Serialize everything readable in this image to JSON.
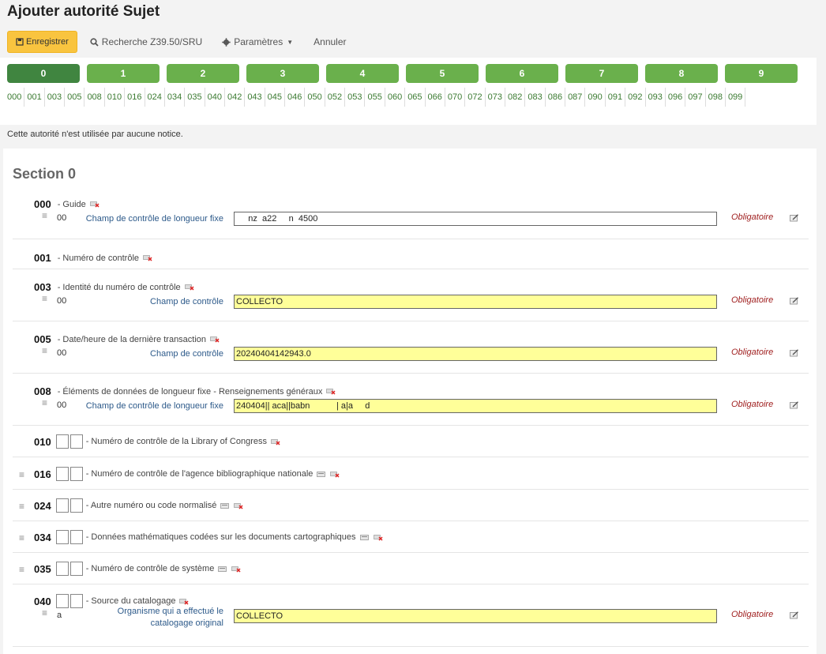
{
  "page": {
    "title": "Ajouter autorité Sujet"
  },
  "toolbar": {
    "save_label": "Enregistrer",
    "search_label": "Recherche Z39.50/SRU",
    "settings_label": "Paramètres",
    "cancel_label": "Annuler"
  },
  "tabs": [
    "0",
    "1",
    "2",
    "3",
    "4",
    "5",
    "6",
    "7",
    "8",
    "9"
  ],
  "field_links": [
    "000",
    "001",
    "003",
    "005",
    "008",
    "010",
    "016",
    "024",
    "034",
    "035",
    "040",
    "042",
    "043",
    "045",
    "046",
    "050",
    "052",
    "053",
    "055",
    "060",
    "065",
    "066",
    "070",
    "072",
    "073",
    "082",
    "083",
    "086",
    "087",
    "090",
    "091",
    "092",
    "093",
    "096",
    "097",
    "098",
    "099"
  ],
  "notice": "Cette autorité n'est utilisée par aucune notice.",
  "section_title": "Section 0",
  "mandatory_label": "Obligatoire",
  "tags": [
    {
      "num": "000",
      "desc": "- Guide",
      "sub": {
        "code": "00",
        "label": "Champ de contrôle de longueur fixe",
        "value": "     nz  a22     n  4500"
      }
    },
    {
      "num": "001",
      "desc": "- Numéro de contrôle"
    },
    {
      "num": "003",
      "desc": "- Identité du numéro de contrôle",
      "sub": {
        "code": "00",
        "label": "Champ de contrôle",
        "value": "COLLECTO"
      }
    },
    {
      "num": "005",
      "desc": "- Date/heure de la dernière transaction",
      "sub": {
        "code": "00",
        "label": "Champ de contrôle",
        "value": "20240404142943.0"
      }
    },
    {
      "num": "008",
      "desc": "- Éléments de données de longueur fixe - Renseignements généraux",
      "sub": {
        "code": "00",
        "label": "Champ de contrôle de longueur fixe",
        "value": "240404|| aca||babn           | a|a     d"
      }
    },
    {
      "num": "010",
      "desc": "- Numéro de contrôle de la Library of Congress"
    },
    {
      "num": "016",
      "desc": "- Numéro de contrôle de l'agence bibliographique nationale"
    },
    {
      "num": "024",
      "desc": "- Autre numéro ou code normalisé"
    },
    {
      "num": "034",
      "desc": "- Données mathématiques codées sur les documents cartographiques"
    },
    {
      "num": "035",
      "desc": "- Numéro de contrôle de système"
    },
    {
      "num": "040",
      "desc": "- Source du catalogage",
      "sub": {
        "code": "a",
        "label": "Organisme qui a effectué le catalogage original",
        "value": "COLLECTO"
      }
    }
  ]
}
